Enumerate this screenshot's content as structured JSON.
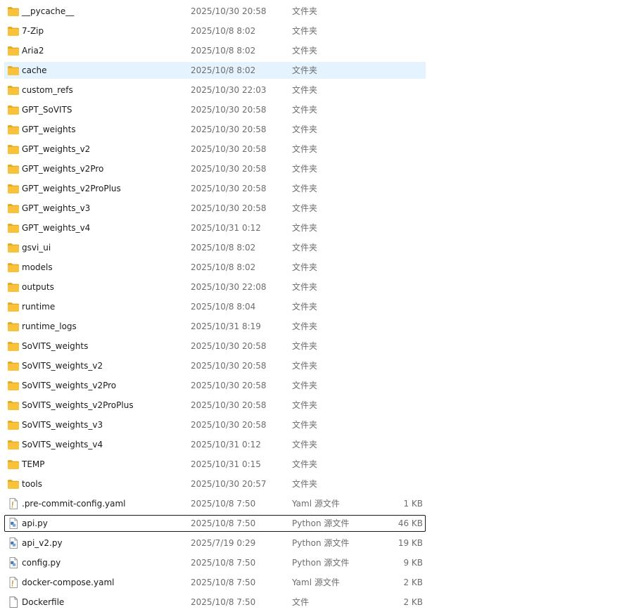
{
  "colors": {
    "folder": "#f8c23a",
    "folder_dark": "#e6a91f",
    "hover_bg": "#e5f3ff",
    "meta_text": "#6d6d6d"
  },
  "rows": [
    {
      "name": "__pycache__",
      "date": "2025/10/30 20:58",
      "type": "文件夹",
      "size": "",
      "icon": "folder-icon"
    },
    {
      "name": "7-Zip",
      "date": "2025/10/8 8:02",
      "type": "文件夹",
      "size": "",
      "icon": "folder-icon"
    },
    {
      "name": "Aria2",
      "date": "2025/10/8 8:02",
      "type": "文件夹",
      "size": "",
      "icon": "folder-icon"
    },
    {
      "name": "cache",
      "date": "2025/10/8 8:02",
      "type": "文件夹",
      "size": "",
      "icon": "folder-icon",
      "state": "hover"
    },
    {
      "name": "custom_refs",
      "date": "2025/10/30 22:03",
      "type": "文件夹",
      "size": "",
      "icon": "folder-icon"
    },
    {
      "name": "GPT_SoVITS",
      "date": "2025/10/30 20:58",
      "type": "文件夹",
      "size": "",
      "icon": "folder-icon"
    },
    {
      "name": "GPT_weights",
      "date": "2025/10/30 20:58",
      "type": "文件夹",
      "size": "",
      "icon": "folder-icon"
    },
    {
      "name": "GPT_weights_v2",
      "date": "2025/10/30 20:58",
      "type": "文件夹",
      "size": "",
      "icon": "folder-icon"
    },
    {
      "name": "GPT_weights_v2Pro",
      "date": "2025/10/30 20:58",
      "type": "文件夹",
      "size": "",
      "icon": "folder-icon"
    },
    {
      "name": "GPT_weights_v2ProPlus",
      "date": "2025/10/30 20:58",
      "type": "文件夹",
      "size": "",
      "icon": "folder-icon"
    },
    {
      "name": "GPT_weights_v3",
      "date": "2025/10/30 20:58",
      "type": "文件夹",
      "size": "",
      "icon": "folder-icon"
    },
    {
      "name": "GPT_weights_v4",
      "date": "2025/10/31 0:12",
      "type": "文件夹",
      "size": "",
      "icon": "folder-icon"
    },
    {
      "name": "gsvi_ui",
      "date": "2025/10/8 8:02",
      "type": "文件夹",
      "size": "",
      "icon": "folder-icon"
    },
    {
      "name": "models",
      "date": "2025/10/8 8:02",
      "type": "文件夹",
      "size": "",
      "icon": "folder-icon"
    },
    {
      "name": "outputs",
      "date": "2025/10/30 22:08",
      "type": "文件夹",
      "size": "",
      "icon": "folder-icon"
    },
    {
      "name": "runtime",
      "date": "2025/10/8 8:04",
      "type": "文件夹",
      "size": "",
      "icon": "folder-icon"
    },
    {
      "name": "runtime_logs",
      "date": "2025/10/31 8:19",
      "type": "文件夹",
      "size": "",
      "icon": "folder-icon"
    },
    {
      "name": "SoVITS_weights",
      "date": "2025/10/30 20:58",
      "type": "文件夹",
      "size": "",
      "icon": "folder-icon"
    },
    {
      "name": "SoVITS_weights_v2",
      "date": "2025/10/30 20:58",
      "type": "文件夹",
      "size": "",
      "icon": "folder-icon"
    },
    {
      "name": "SoVITS_weights_v2Pro",
      "date": "2025/10/30 20:58",
      "type": "文件夹",
      "size": "",
      "icon": "folder-icon"
    },
    {
      "name": "SoVITS_weights_v2ProPlus",
      "date": "2025/10/30 20:58",
      "type": "文件夹",
      "size": "",
      "icon": "folder-icon"
    },
    {
      "name": "SoVITS_weights_v3",
      "date": "2025/10/30 20:58",
      "type": "文件夹",
      "size": "",
      "icon": "folder-icon"
    },
    {
      "name": "SoVITS_weights_v4",
      "date": "2025/10/31 0:12",
      "type": "文件夹",
      "size": "",
      "icon": "folder-icon"
    },
    {
      "name": "TEMP",
      "date": "2025/10/31 0:15",
      "type": "文件夹",
      "size": "",
      "icon": "folder-icon"
    },
    {
      "name": "tools",
      "date": "2025/10/30 20:57",
      "type": "文件夹",
      "size": "",
      "icon": "folder-icon"
    },
    {
      "name": ".pre-commit-config.yaml",
      "date": "2025/10/8 7:50",
      "type": "Yaml 源文件",
      "size": "1 KB",
      "icon": "yaml-file-icon"
    },
    {
      "name": "api.py",
      "date": "2025/10/8 7:50",
      "type": "Python 源文件",
      "size": "46 KB",
      "icon": "python-file-icon",
      "state": "focus"
    },
    {
      "name": "api_v2.py",
      "date": "2025/7/19 0:29",
      "type": "Python 源文件",
      "size": "19 KB",
      "icon": "python-file-icon"
    },
    {
      "name": "config.py",
      "date": "2025/10/8 7:50",
      "type": "Python 源文件",
      "size": "9 KB",
      "icon": "python-file-icon"
    },
    {
      "name": "docker-compose.yaml",
      "date": "2025/10/8 7:50",
      "type": "Yaml 源文件",
      "size": "2 KB",
      "icon": "yaml-file-icon"
    },
    {
      "name": "Dockerfile",
      "date": "2025/10/8 7:50",
      "type": "文件",
      "size": "2 KB",
      "icon": "generic-file-icon"
    }
  ]
}
